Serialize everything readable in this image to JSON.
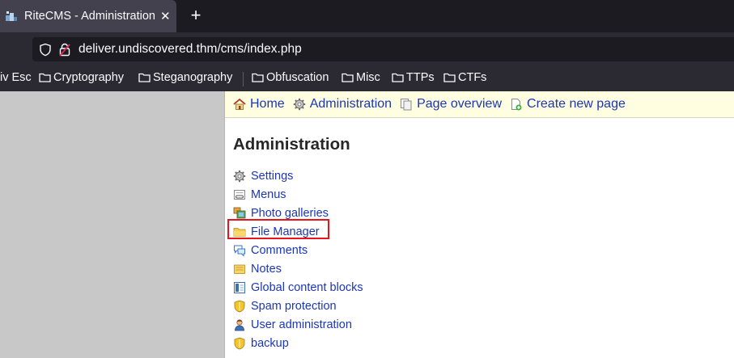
{
  "browser": {
    "tab": {
      "title": "RiteCMS - Administration",
      "close_symbol": "✕",
      "favicon": "ritecms-favicon-icon"
    },
    "new_tab_symbol": "+",
    "url": "deliver.undiscovered.thm/cms/index.php",
    "bookmarks": [
      {
        "label": "iv Esc"
      },
      {
        "label": "Cryptography"
      },
      {
        "label": "Steganography"
      },
      {
        "label": "Obfuscation"
      },
      {
        "label": "Misc"
      },
      {
        "label": "TTPs"
      },
      {
        "label": "CTFs"
      }
    ]
  },
  "page": {
    "topnav": [
      {
        "label": "Home",
        "icon": "home-icon"
      },
      {
        "label": "Administration",
        "icon": "gear-icon"
      },
      {
        "label": "Page overview",
        "icon": "pages-icon"
      },
      {
        "label": "Create new page",
        "icon": "new-page-icon"
      }
    ],
    "title": "Administration",
    "admin_items": [
      {
        "label": "Settings",
        "icon": "gear-icon"
      },
      {
        "label": "Menus",
        "icon": "menu-icon"
      },
      {
        "label": "Photo galleries",
        "icon": "photos-icon"
      },
      {
        "label": "File Manager",
        "icon": "folder-icon",
        "highlighted": true
      },
      {
        "label": "Comments",
        "icon": "comments-icon"
      },
      {
        "label": "Notes",
        "icon": "notes-icon"
      },
      {
        "label": "Global content blocks",
        "icon": "content-block-icon"
      },
      {
        "label": "Spam protection",
        "icon": "shield-icon"
      },
      {
        "label": "User administration",
        "icon": "user-icon"
      },
      {
        "label": "backup",
        "icon": "shield-icon"
      }
    ]
  },
  "colors": {
    "link": "#1b36b9",
    "highlight_border": "#e8161b",
    "topnav_background": "#fffee0",
    "chrome_dark": "#1c1b22"
  }
}
